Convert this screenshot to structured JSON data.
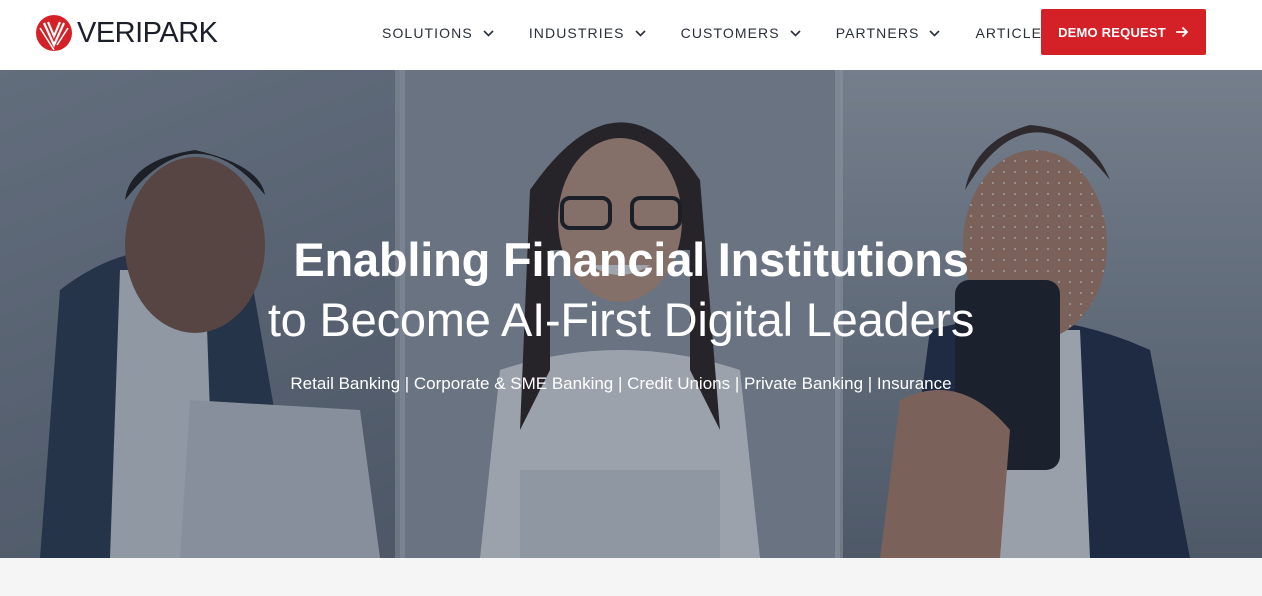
{
  "brand": {
    "name": "VERIPARK",
    "color": "#d42027"
  },
  "nav": {
    "items": [
      {
        "label": "SOLUTIONS",
        "has_dropdown": true
      },
      {
        "label": "INDUSTRIES",
        "has_dropdown": true
      },
      {
        "label": "CUSTOMERS",
        "has_dropdown": true
      },
      {
        "label": "PARTNERS",
        "has_dropdown": true
      },
      {
        "label": "ARTICLES",
        "has_dropdown": false
      }
    ],
    "cta": {
      "label": "DEMO REQUEST",
      "icon": "arrow-right-icon"
    }
  },
  "hero": {
    "title": "Enabling Financial Institutions",
    "subtitle": "to Become AI-First Digital Leaders",
    "segments": "Retail Banking | Corporate & SME Banking | Credit Unions | Private Banking | Insurance",
    "image": "photo-of-three-people-using-laptop-and-phone-with-face-recognition"
  }
}
